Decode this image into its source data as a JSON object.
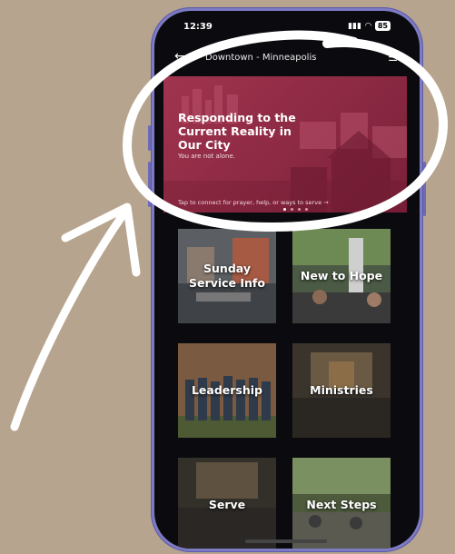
{
  "status_bar": {
    "time": "12:39",
    "battery": "85"
  },
  "nav": {
    "title": "Downtown - Minneapolis"
  },
  "banner": {
    "title": "Responding to the Current Reality in Our City",
    "subtitle": "You are not alone.",
    "cta": "Tap to connect for prayer, help, or ways to serve →",
    "slides_total": 4,
    "slide_active": 1
  },
  "tiles": [
    {
      "label": "Sunday Service Info"
    },
    {
      "label": "New to Hope"
    },
    {
      "label": "Leadership"
    },
    {
      "label": "Ministries"
    },
    {
      "label": "Serve"
    },
    {
      "label": "Next Steps"
    }
  ],
  "colors": {
    "page_background": "#b7a48f",
    "phone_frame": "#7d7bc4",
    "banner_overlay": "#a0344e",
    "annotation": "#ffffff"
  }
}
